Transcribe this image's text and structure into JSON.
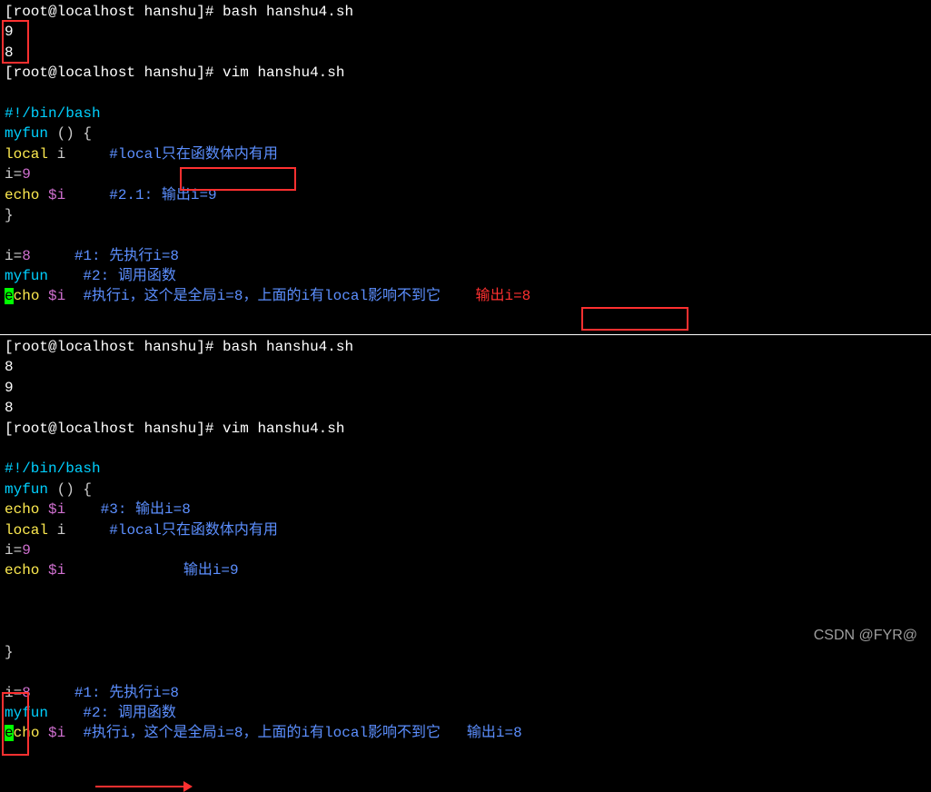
{
  "watermark": "CSDN @FYR@",
  "top": {
    "prompt1": "[root@localhost hanshu]# ",
    "cmd1": "bash hanshu4.sh",
    "out1": "9",
    "out2": "8",
    "prompt2": "[root@localhost hanshu]# ",
    "cmd2": "vim hanshu4.sh",
    "script": {
      "shebang": "#!/bin/bash",
      "l1_a": "myfun",
      "l1_b": " () {",
      "l2_a": "local",
      "l2_b": " i     ",
      "l2_c": "#local只在函数体内有用",
      "l3_a": "i=",
      "l3_b": "9",
      "l4_a": "echo",
      "l4_b": " $i",
      "l4_c": "     #2.1: ",
      "l4_d": "输出i=9",
      "l5": "}",
      "l7_a": "i=",
      "l7_b": "8",
      "l7_c": "     #1: 先执行i=8",
      "l8_a": "myfun",
      "l8_b": "    #2: 调用函数",
      "l9_e": "e",
      "l9_a": "cho",
      "l9_b": " $i",
      "l9_c": "  #执行i，这个是全局i=8，上面的i有local影响不到它",
      "l9_d": "    输出i=8"
    }
  },
  "bottom": {
    "prompt1": "[root@localhost hanshu]# ",
    "cmd1": "bash hanshu4.sh",
    "out1": "8",
    "out2": "9",
    "out3": "8",
    "prompt2": "[root@localhost hanshu]# ",
    "cmd2": "vim hanshu4.sh",
    "script": {
      "shebang": "#!/bin/bash",
      "l1_a": "myfun",
      "l1_b": " () {",
      "l2_a": "echo",
      "l2_b": " $i",
      "l2_c": "    #3: 输出i=8",
      "l3_a": "local",
      "l3_b": " i     ",
      "l3_c": "#local只在函数体内有用",
      "l4_a": "i=",
      "l4_b": "9",
      "l5_a": "echo",
      "l5_b": " $i",
      "l5_c": " ",
      "l5_arrow_label": "输出i=9",
      "l6": "}",
      "l8_a": "i=",
      "l8_b": "8",
      "l8_c": "     #1: 先执行i=8",
      "l9_a": "myfun",
      "l9_b": "    #2: 调用函数",
      "l10_e": "e",
      "l10_a": "cho",
      "l10_b": " $i",
      "l10_c": "  #执行i，这个是全局i=8，上面的i有local影响不到它   输出i=8"
    }
  }
}
